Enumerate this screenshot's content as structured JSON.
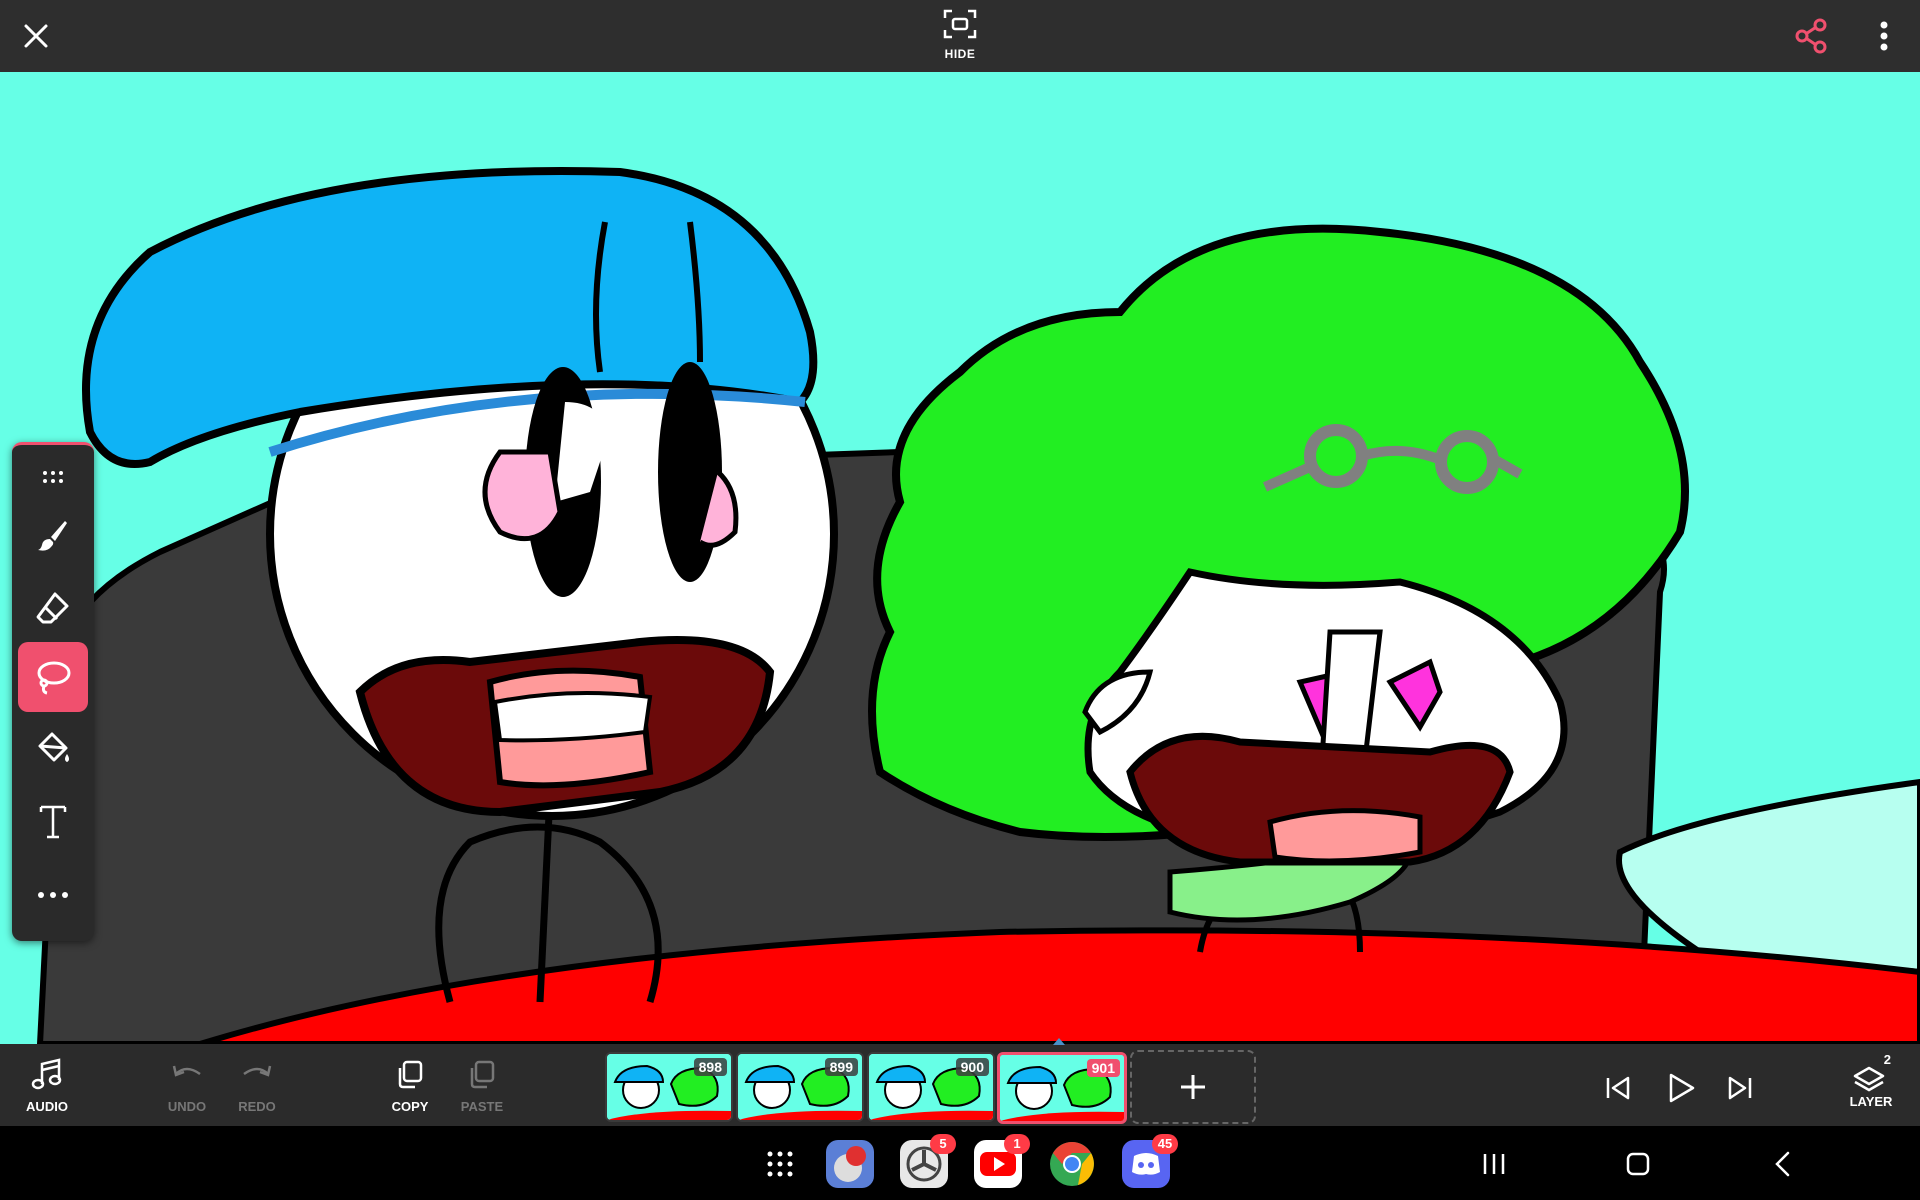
{
  "top_bar": {
    "hide_label": "HIDE"
  },
  "toolbox": {
    "tools": [
      "drag-handle",
      "brush",
      "eraser",
      "lasso",
      "fill",
      "text",
      "more"
    ],
    "active_tool": "lasso"
  },
  "bottom_bar": {
    "audio_label": "AUDIO",
    "undo_label": "UNDO",
    "redo_label": "REDO",
    "copy_label": "COPY",
    "paste_label": "PASTE",
    "layer_label": "LAYER",
    "layer_count": "2",
    "frames": [
      {
        "number": "898"
      },
      {
        "number": "899"
      },
      {
        "number": "900"
      },
      {
        "number": "901"
      }
    ],
    "selected_frame": "901"
  },
  "system_nav": {
    "apps": [
      {
        "name": "app-drawer"
      },
      {
        "name": "game-app"
      },
      {
        "name": "fan-app",
        "badge": "5"
      },
      {
        "name": "youtube",
        "badge": "1"
      },
      {
        "name": "chrome"
      },
      {
        "name": "discord",
        "badge": "45"
      }
    ]
  },
  "colors": {
    "accent": "#f0506e",
    "canvas_bg": "#66ffe6",
    "bar_bg": "#2e2e2e"
  }
}
